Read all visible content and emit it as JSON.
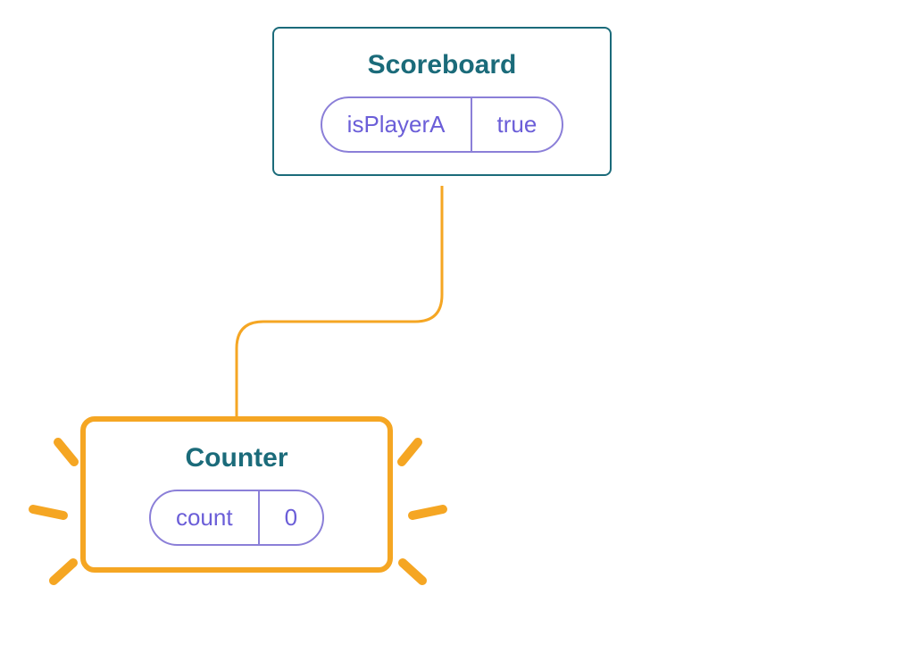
{
  "scoreboard": {
    "title": "Scoreboard",
    "state_key": "isPlayerA",
    "state_value": "true"
  },
  "counter": {
    "title": "Counter",
    "state_key": "count",
    "state_value": "0"
  }
}
